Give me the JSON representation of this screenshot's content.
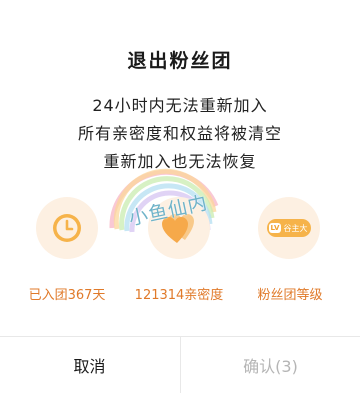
{
  "dialog": {
    "title": "退出粉丝团",
    "message_lines": [
      "24小时内无法重新加入",
      "所有亲密度和权益将被清空",
      "重新加入也无法恢复"
    ],
    "watermark": "小鱼仙内",
    "benefits": [
      {
        "icon": "clock-icon",
        "label": "已入团367天"
      },
      {
        "icon": "heart-icon",
        "label": "121314亲密度"
      },
      {
        "icon": "fan-badge-icon",
        "label": "粉丝团等级",
        "badge_level": "LV",
        "badge_text": "谷主大"
      }
    ],
    "buttons": {
      "cancel": "取消",
      "confirm": "确认(3)"
    }
  },
  "colors": {
    "accent": "#e07a2a",
    "icon_bg": "#fdf0e2",
    "icon_fill": "#f6b34a",
    "disabled": "#b5b5b5"
  }
}
